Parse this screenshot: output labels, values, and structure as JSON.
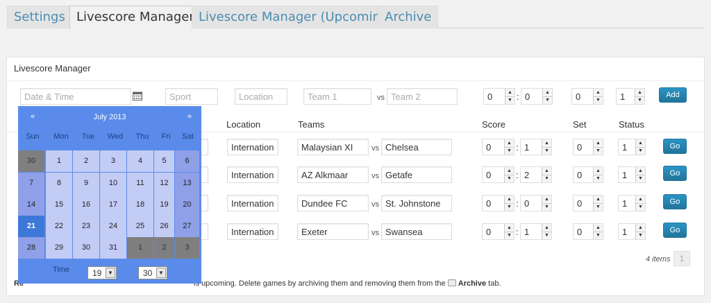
{
  "tabs": [
    {
      "label": "Settings"
    },
    {
      "label": "Livescore Manager",
      "active": true
    },
    {
      "label": "Livescore Manager (Upcoming)"
    },
    {
      "label": "Archive"
    }
  ],
  "panel": {
    "title": "Livescore Manager"
  },
  "new_game": {
    "datetime_placeholder": "Date & Time",
    "sport_placeholder": "Sport",
    "location_placeholder": "Location",
    "team1_placeholder": "Team 1",
    "vs": "vs",
    "team2_placeholder": "Team 2",
    "score1": "0",
    "score2": "0",
    "set": "0",
    "status": "1",
    "add_label": "Add"
  },
  "columns": {
    "location": "Location",
    "teams": "Teams",
    "score": "Score",
    "set": "Set",
    "status": "Status"
  },
  "rows": [
    {
      "location": "International",
      "team1": "Malaysian XI",
      "team2": "Chelsea",
      "score1": "0",
      "score2": "1",
      "set": "0",
      "status": "1",
      "go": "Go"
    },
    {
      "location": "International",
      "team1": "AZ Alkmaar",
      "team2": "Getafe",
      "score1": "0",
      "score2": "2",
      "set": "0",
      "status": "1",
      "go": "Go"
    },
    {
      "location": "International",
      "team1": "Dundee FC",
      "team2": "St. Johnstone",
      "score1": "0",
      "score2": "0",
      "set": "0",
      "status": "1",
      "go": "Go"
    },
    {
      "location": "International",
      "team1": "Exeter",
      "team2": "Swansea",
      "score1": "0",
      "score2": "1",
      "set": "0",
      "status": "1",
      "go": "Go"
    }
  ],
  "pagination": {
    "items": "4 items",
    "page": "1"
  },
  "footer": {
    "left_partial": "Re",
    "text": "is upcoming. Delete games by archiving them and removing them from the",
    "archive": "Archive",
    "suffix": "tab."
  },
  "datepicker": {
    "month": "July 2013",
    "prev": "«",
    "next": "»",
    "dow": [
      "Sun",
      "Mon",
      "Tue",
      "Wed",
      "Thu",
      "Fri",
      "Sat"
    ],
    "weeks": [
      [
        "30",
        "1",
        "2",
        "3",
        "4",
        "5",
        "6"
      ],
      [
        "7",
        "8",
        "9",
        "10",
        "11",
        "12",
        "13"
      ],
      [
        "14",
        "15",
        "16",
        "17",
        "18",
        "19",
        "20"
      ],
      [
        "21",
        "22",
        "23",
        "24",
        "25",
        "26",
        "27"
      ],
      [
        "28",
        "29",
        "30",
        "31",
        "1",
        "2",
        "3"
      ]
    ],
    "time_label": "Time",
    "hour": "19",
    "minute": "30"
  }
}
